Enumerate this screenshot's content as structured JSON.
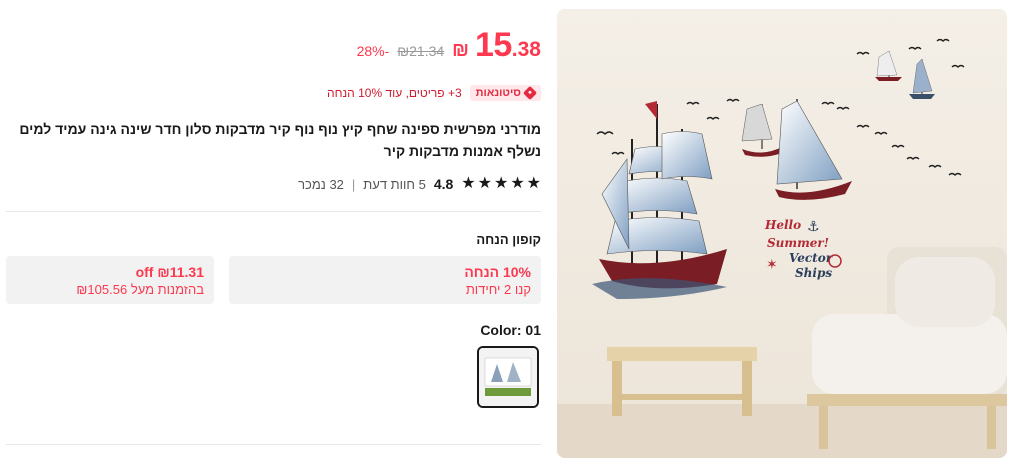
{
  "price": {
    "currency_symbol": "₪",
    "integer": "15",
    "decimal": ".38",
    "original": "₪21.34",
    "discount": "28%-"
  },
  "promo": {
    "badge": "סיטונאות",
    "text": "3+ פריטים, עוד 10% הנחה"
  },
  "product": {
    "title": "מודרני מפרשית ספינה שחף קיץ נוף נוף קיר מדבקות סלון חדר שינה גינה עמיד למים נשלף אמנות מדבקות קיר"
  },
  "rating": {
    "stars": 5,
    "value": "4.8",
    "reviews": "5 חוות דעת",
    "sold": "32 נמכר"
  },
  "coupons": {
    "heading": "קופון הנחה",
    "items": [
      {
        "title": "10% הנחה",
        "subtitle": "קנו 2 יחידות"
      },
      {
        "title": "₪11.31 off",
        "subtitle": "בהזמנות מעל ₪105.56"
      }
    ]
  },
  "variant": {
    "color_label": "Color: 01"
  },
  "image": {
    "decal_text": [
      "Hello",
      "Summer!",
      "Vector",
      "Ships"
    ]
  },
  "colors": {
    "accent": "#fd384f",
    "badge_bg": "#ffe7ea",
    "coupon_bg": "#f2f2f2"
  }
}
